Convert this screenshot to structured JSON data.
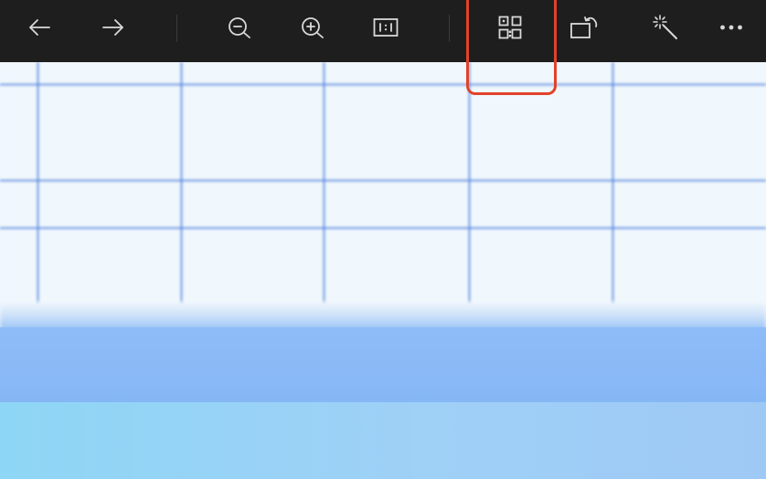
{
  "toolbar": {
    "buttons": [
      {
        "name": "back-button",
        "icon": "arrow-left-icon"
      },
      {
        "name": "forward-button",
        "icon": "arrow-right-icon"
      },
      {
        "name": "zoom-out-button",
        "icon": "zoom-out-icon"
      },
      {
        "name": "zoom-in-button",
        "icon": "zoom-in-icon"
      },
      {
        "name": "actual-size-button",
        "icon": "one-to-one-icon",
        "label": "1:1"
      },
      {
        "name": "scan-qr-button",
        "icon": "qr-code-icon",
        "highlighted": true
      },
      {
        "name": "rotate-button",
        "icon": "rotate-icon"
      },
      {
        "name": "auto-enhance-button",
        "icon": "magic-wand-icon"
      },
      {
        "name": "more-button",
        "icon": "more-icon"
      }
    ],
    "highlight_color": "#e0432a",
    "background": "#1e1e1e",
    "icon_color": "#d9d9d9"
  },
  "image": {
    "description_colors": {
      "paper": "#f1f8fd",
      "grid_lines": "#5082dc",
      "blue_band": "#8ebcf8",
      "sky_band": "#8ed6f5"
    }
  }
}
